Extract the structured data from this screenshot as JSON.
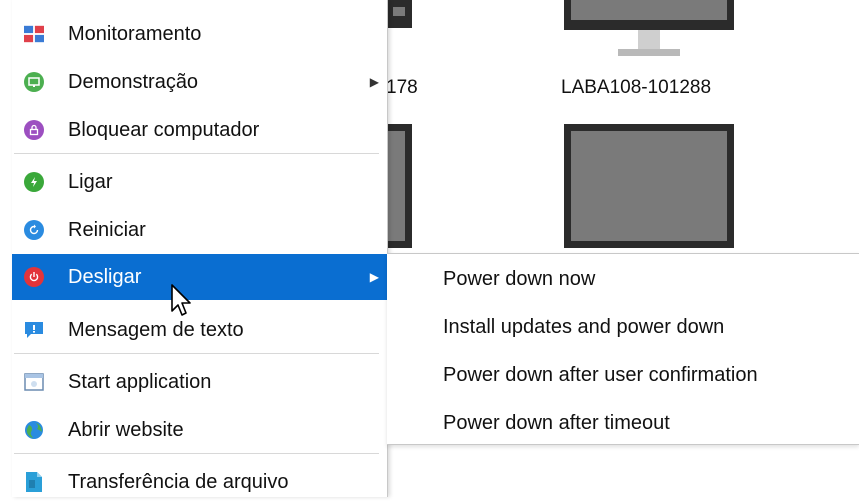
{
  "computers": [
    {
      "label": "178"
    },
    {
      "label": "LABA108-101288"
    }
  ],
  "menu": {
    "items": [
      {
        "label": "Monitoramento",
        "icon": "monitor-tiles-icon",
        "has_submenu": false
      },
      {
        "label": "Demonstração",
        "icon": "demonstration-icon",
        "has_submenu": true
      },
      {
        "label": "Bloquear computador",
        "icon": "lock-icon",
        "has_submenu": false
      },
      {
        "label": "Ligar",
        "icon": "power-on-icon",
        "has_submenu": false
      },
      {
        "label": "Reiniciar",
        "icon": "reboot-icon",
        "has_submenu": false
      },
      {
        "label": "Desligar",
        "icon": "power-off-icon",
        "has_submenu": true,
        "active": true
      },
      {
        "label": "Mensagem de texto",
        "icon": "text-message-icon",
        "has_submenu": false
      },
      {
        "label": "Start application",
        "icon": "application-window-icon",
        "has_submenu": false
      },
      {
        "label": "Abrir website",
        "icon": "globe-icon",
        "has_submenu": false
      },
      {
        "label": "Transferência de arquivo",
        "icon": "file-transfer-icon",
        "has_submenu": false
      }
    ],
    "arrow_glyph": "▶"
  },
  "submenu": {
    "items": [
      {
        "label": "Power down now"
      },
      {
        "label": "Install updates and power down"
      },
      {
        "label": "Power down after user confirmation"
      },
      {
        "label": "Power down after timeout"
      }
    ]
  },
  "colors": {
    "highlight": "#0a6ed1",
    "menu_bg": "#ffffff",
    "separator": "#d8d8d8"
  }
}
